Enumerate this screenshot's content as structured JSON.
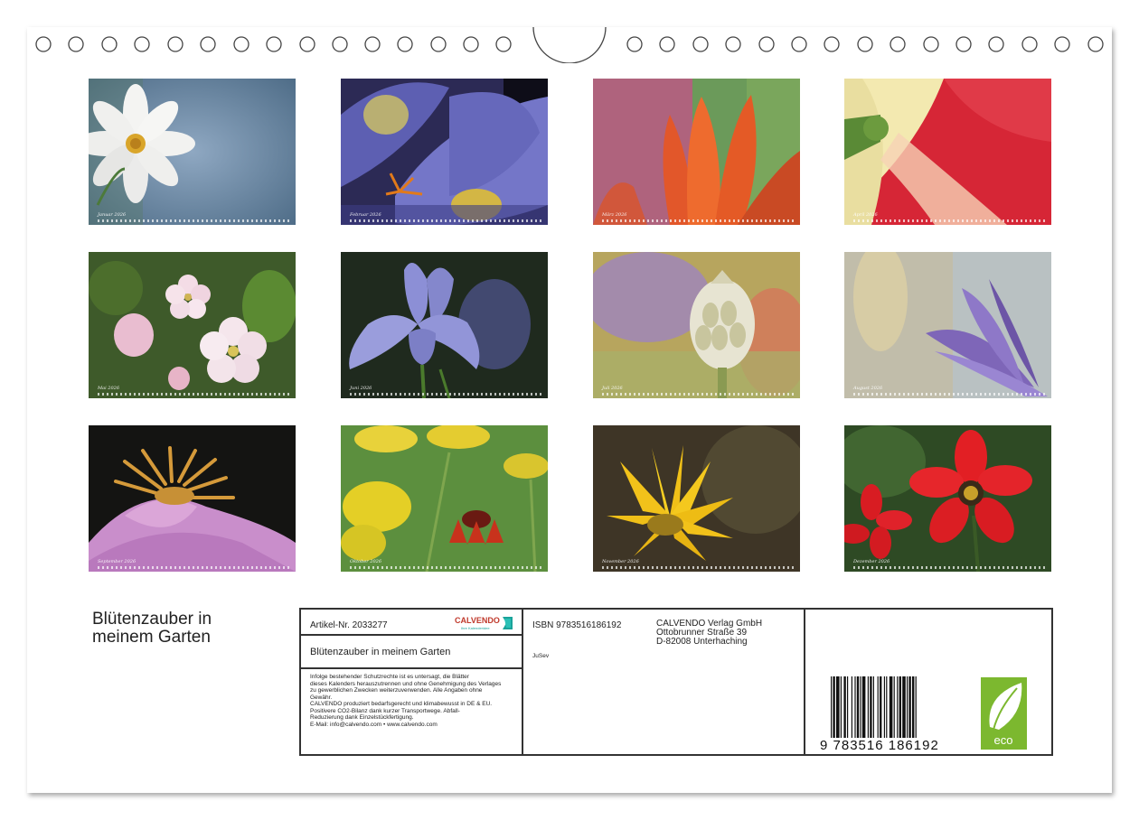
{
  "calendar": {
    "title": "Blütenzauber in meinem Garten",
    "title_line1": "Blütenzauber in",
    "title_line2": "meinem Garten",
    "months": [
      {
        "caption": "Januar 2026",
        "icon": "white-cosmos-flower"
      },
      {
        "caption": "Februar 2026",
        "icon": "blue-crocus-flower"
      },
      {
        "caption": "März 2026",
        "icon": "orange-tulip-flower"
      },
      {
        "caption": "April 2026",
        "icon": "red-tulip-closeup"
      },
      {
        "caption": "Mai 2026",
        "icon": "apple-blossom"
      },
      {
        "caption": "Juni 2026",
        "icon": "iris-flower"
      },
      {
        "caption": "Juli 2026",
        "icon": "cornflower-bud"
      },
      {
        "caption": "August 2026",
        "icon": "purple-lily-flower"
      },
      {
        "caption": "September 2026",
        "icon": "pink-anemone-flower"
      },
      {
        "caption": "Oktober 2026",
        "icon": "yarrow-and-helenium"
      },
      {
        "caption": "November 2026",
        "icon": "yellow-sunflower"
      },
      {
        "caption": "Dezember 2026",
        "icon": "red-dahlia-flower"
      }
    ]
  },
  "info": {
    "article": "Artikel-Nr. 2033277",
    "brand": "CALVENDO",
    "brand_tagline": "Ihre Kalenderidee",
    "product_title": "Blütenzauber in meinem Garten",
    "legal_lines": [
      "Infolge bestehender Schutzrechte ist es untersagt, die Blätter",
      "dieses Kalenders herauszutrennen und ohne Genehmigung des Verlages",
      "zu gewerblichen Zwecken weiterzuverwenden. Alle Angaben ohne",
      "Gewähr.",
      "CALVENDO produziert bedarfsgerecht und klimabewusst in DE & EU.",
      "Positivere CO2-Bilanz dank kurzer Transportwege. Abfall-",
      "Reduzierung dank Einzelstückfertigung.",
      "E-Mail: info@calvendo.com • www.calvendo.com"
    ],
    "isbn": "ISBN 9783516186192",
    "author": "JuSev",
    "publisher_lines": [
      "CALVENDO Verlag GmbH",
      "Ottobrunner Straße 39",
      "D-82008 Unterhaching"
    ],
    "ean_text": "9  783516  186192",
    "eco_label": "eco"
  },
  "colors": {
    "border": "#333333",
    "eco_green": "#7cb82f",
    "brand_red": "#c0392b",
    "brand_teal": "#1aa39a"
  }
}
